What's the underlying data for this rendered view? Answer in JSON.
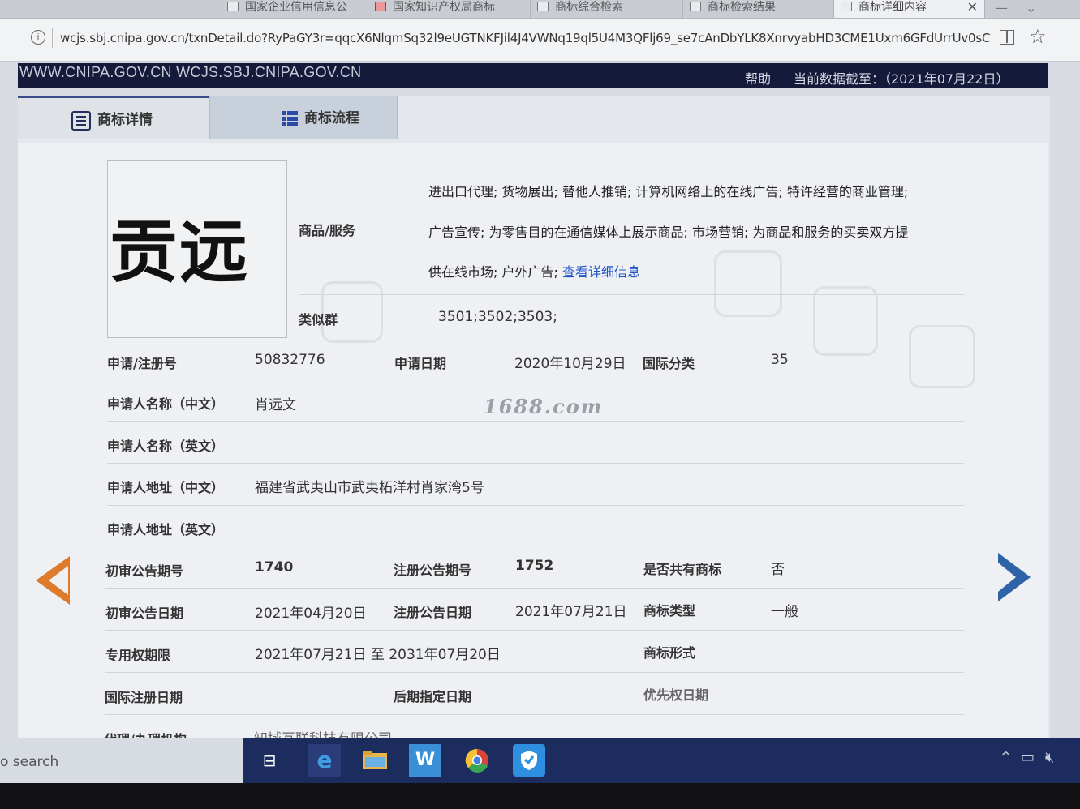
{
  "browser": {
    "tabs": [
      {
        "label": "国家企业信用信息公"
      },
      {
        "label": "国家知识产权局商标"
      },
      {
        "label": "商标综合检索"
      },
      {
        "label": "商标检索结果"
      },
      {
        "label": "商标详细内容"
      }
    ],
    "url": "wcjs.sbj.cnipa.gov.cn/txnDetail.do?RyPaGY3r=qqcX6NlqmSq32l9eUGTNKFJil4J4VWNq19ql5U4M3QFlj69_se7cAnDbYLK8XnrvyabHD3CME1Uxm6GFdUrrUv0sC"
  },
  "site": {
    "domains": "WWW.CNIPA.GOV.CN WCJS.SBJ.CNIPA.GOV.CN",
    "help": "帮助",
    "data_date": "当前数据截至：（2021年07月22日）"
  },
  "tabs": {
    "detail": "商标详情",
    "flow": "商标流程"
  },
  "mark": {
    "name": "贡远"
  },
  "goods": {
    "label": "商品/服务",
    "line1": "进出口代理; 货物展出; 替他人推销; 计算机网络上的在线广告; 特许经营的商业管理;",
    "line2": "广告宣传; 为零售目的在通信媒体上展示商品; 市场营销; 为商品和服务的买卖双方提",
    "line3": "供在线市场; 户外广告;",
    "link": "查看详细信息"
  },
  "similar": {
    "label": "类似群",
    "value": "3501;3502;3503;"
  },
  "fields": {
    "reg_no_label": "申请/注册号",
    "reg_no": "50832776",
    "app_date_label": "申请日期",
    "app_date": "2020年10月29日",
    "intl_class_label": "国际分类",
    "intl_class": "35",
    "applicant_cn_label": "申请人名称（中文）",
    "applicant_cn": "肖远文",
    "applicant_en_label": "申请人名称（英文）",
    "address_cn_label": "申请人地址（中文）",
    "address_cn": "福建省武夷山市武夷柘洋村肖家湾5号",
    "address_en_label": "申请人地址（英文）",
    "prelim_no_label": "初审公告期号",
    "prelim_no": "1740",
    "reg_pub_no_label": "注册公告期号",
    "reg_pub_no": "1752",
    "shared_label": "是否共有商标",
    "shared": "否",
    "prelim_date_label": "初审公告日期",
    "prelim_date": "2021年04月20日",
    "reg_pub_date_label": "注册公告日期",
    "reg_pub_date": "2021年07月21日",
    "mark_type_label": "商标类型",
    "mark_type": "一般",
    "exclusive_label": "专用权期限",
    "exclusive": "2021年07月21日 至 2031年07月20日",
    "mark_form_label": "商标形式",
    "intl_reg_label": "国际注册日期",
    "later_date_label": "后期指定日期",
    "priority_label": "优先权日期",
    "agent_label": "代理/办理机构",
    "agent": "知域互联科技有限公司"
  },
  "watermark": "1688.com",
  "taskbar": {
    "search": "o search"
  }
}
